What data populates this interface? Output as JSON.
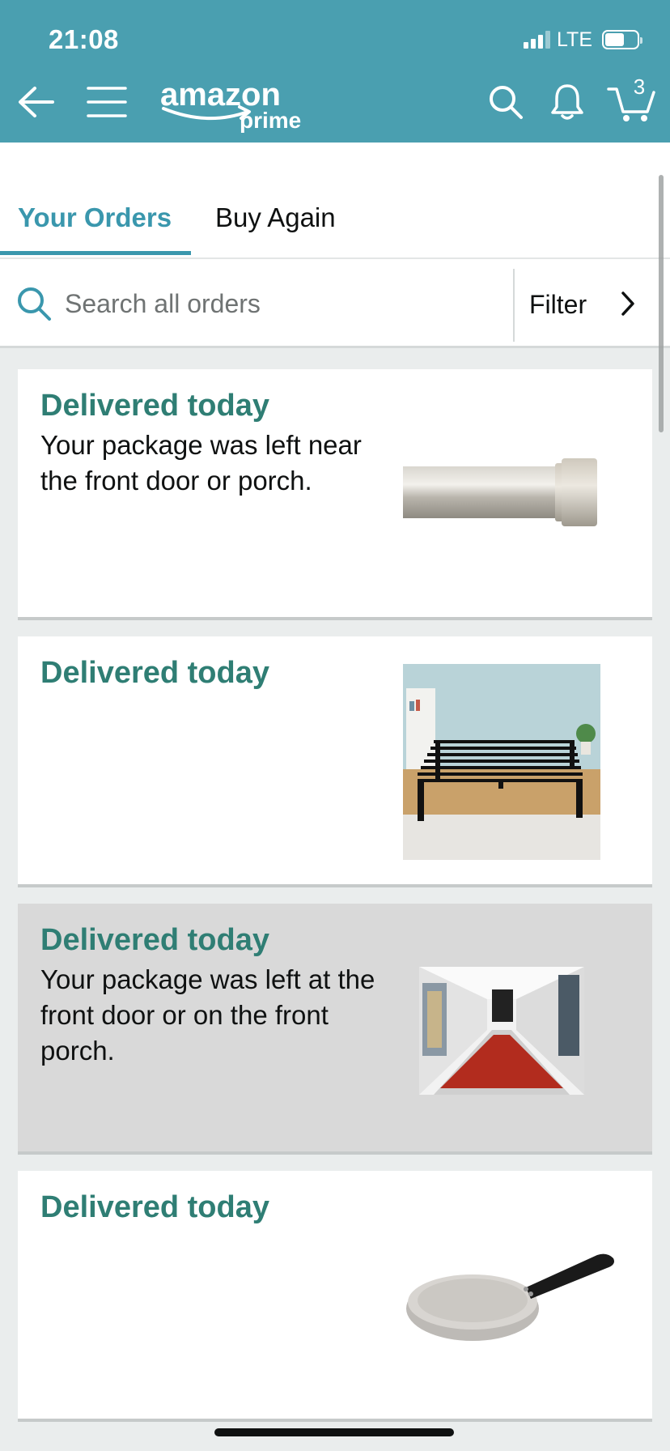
{
  "status_bar": {
    "time": "21:08",
    "network": "LTE",
    "battery_level": 0.6
  },
  "header": {
    "cart_count": "3",
    "icons": [
      "back-arrow-icon",
      "hamburger-menu-icon",
      "search-icon",
      "bell-icon",
      "cart-icon"
    ],
    "logo": {
      "word": "amazon",
      "sub": "prime"
    }
  },
  "tabs": [
    {
      "label": "Your Orders",
      "active": true
    },
    {
      "label": "Buy Again",
      "active": false
    }
  ],
  "search": {
    "placeholder": "Search all orders",
    "value": "",
    "filter_label": "Filter"
  },
  "orders": [
    {
      "status": "Delivered today",
      "note": "Your package was left near the front door or porch.",
      "product": "curtain-rod",
      "highlighted": false
    },
    {
      "status": "Delivered today",
      "note": "",
      "product": "bed-frame",
      "highlighted": false
    },
    {
      "status": "Delivered today",
      "note": "Your package was left at the front door or on the front porch.",
      "product": "red-runner-rug",
      "highlighted": true
    },
    {
      "status": "Delivered today",
      "note": "",
      "product": "frying-pan",
      "highlighted": false
    }
  ],
  "colors": {
    "header_bg": "#4a9fb0",
    "accent": "#3a97ad",
    "status_text": "#2f7e74",
    "page_bg": "#eaeded"
  }
}
